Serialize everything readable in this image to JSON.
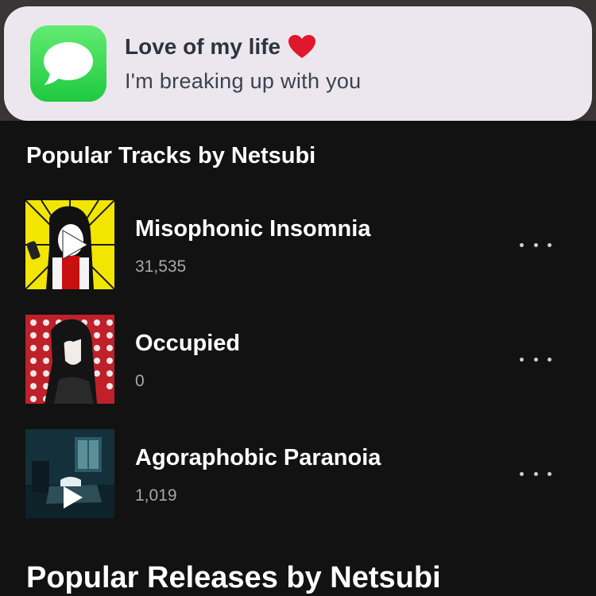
{
  "notification": {
    "app_icon": "messages-icon",
    "title": "Love of my life",
    "title_emoji": "heart-icon",
    "body": "I'm breaking up with you",
    "icon_color": "#34c759",
    "heart_color": "#e0182d"
  },
  "popular_tracks": {
    "heading": "Popular Tracks by Netsubi",
    "items": [
      {
        "title": "Misophonic Insomnia",
        "count": "31,535",
        "art": "yellow-burst-cover",
        "playing_overlay": "play-icon"
      },
      {
        "title": "Occupied",
        "count": "0",
        "art": "red-pattern-portrait-cover"
      },
      {
        "title": "Agoraphobic Paranoia",
        "count": "1,019",
        "art": "dark-room-cover",
        "playing_overlay": "play-icon"
      }
    ],
    "more_icon": "more-options-icon"
  },
  "popular_releases": {
    "heading": "Popular Releases by Netsubi"
  }
}
